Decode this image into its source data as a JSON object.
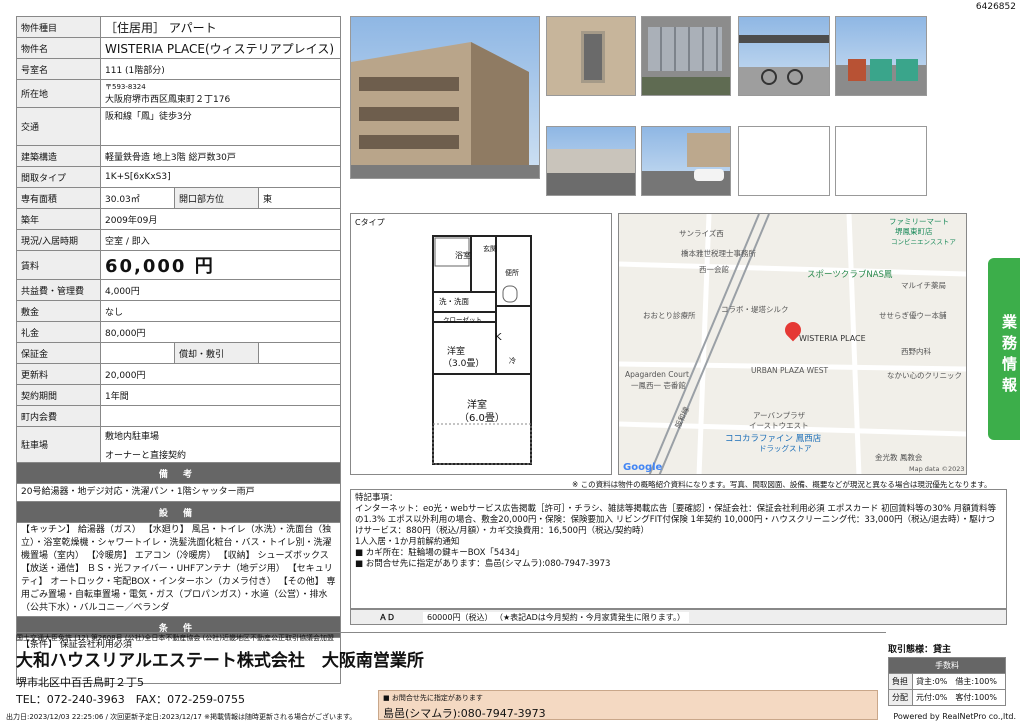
{
  "doc_id": "6426852",
  "spec": {
    "rows": [
      {
        "label": "物件種目",
        "value": "［住居用］ アパート"
      },
      {
        "label": "物件名",
        "value": "WISTERIA PLACE(ウィステリアプレイス)"
      },
      {
        "label": "号室名",
        "value": "111 (1階部分)"
      },
      {
        "label": "所在地",
        "value_top": "〒593-8324",
        "value": "大阪府堺市西区鳳東町２丁176"
      },
      {
        "label": "交通",
        "value": "阪和線「鳳」徒歩3分"
      },
      {
        "label": "建築構造",
        "value": "軽量鉄骨造 地上3階 総戸数30戸"
      },
      {
        "label": "間取タイプ",
        "value": "1K+S[6xKxS3]"
      },
      {
        "label": "専有面積",
        "value": "30.03㎡",
        "label2": "開口部方位",
        "value2": "東"
      },
      {
        "label": "築年",
        "value": "2009年09月"
      },
      {
        "label": "現況/入居時期",
        "value": "空室 / 即入"
      },
      {
        "label": "賃料",
        "value": "60,000 円"
      },
      {
        "label": "共益費・管理費",
        "value": "4,000円"
      },
      {
        "label": "敷金",
        "value": "なし"
      },
      {
        "label": "礼金",
        "value": "80,000円"
      },
      {
        "label": "保証金",
        "value": "",
        "label2": "償却・敷引",
        "value2": ""
      },
      {
        "label": "更新料",
        "value": "20,000円"
      },
      {
        "label": "契約期間",
        "value": "1年間"
      },
      {
        "label": "町内会費",
        "value": ""
      },
      {
        "label": "駐車場",
        "value": "敷地内駐車場",
        "value_b": "オーナーと直接契約"
      }
    ],
    "bikou_title": "備 考",
    "bikou_text": "20号給湯器・地デジ対応・洗濯パン・1階シャッター雨戸",
    "setsubi_title": "設 備",
    "setsubi_text": "【キッチン】 給湯器（ガス） 【水廻り】 風呂・トイレ（水洗）・洗面台（独立）・浴室乾燥機・シャワートイレ・洗髪洗面化粧台・バス・トイレ別・洗濯機置場（室内） 【冷暖房】 エアコン（冷暖房） 【収納】 シューズボックス 【放送・通信】 ＢＳ・光ファイバー・UHFアンテナ（地デジ用） 【セキュリティ】 オートロック・宅配BOX・インターホン（カメラ付き） 【その他】 専用ごみ置場・自転車置場・電気・ガス（プロパンガス）・水道（公営）・排水（公共下水）・バルコニー／ベランダ",
    "joken_title": "条 件",
    "joken_text": "【条件】 保証会社利用必須"
  },
  "floorplan": {
    "caption": "Cタイプ",
    "rooms": [
      "浴室",
      "玄関",
      "洗・洗面",
      "クローゼット",
      "便所",
      "洋室",
      "（3.0畳）",
      "K",
      "冷",
      "洋室",
      "（6.0畳）"
    ]
  },
  "map": {
    "labels": [
      "サンライズ西",
      "橋本雅世税理士事務所",
      "西一会館",
      "ファミリーマート",
      "堺鳳東町店",
      "コンビニエンスストア",
      "スポーツクラブNAS鳳",
      "マルイチ薬局",
      "おおとり診療所",
      "コラボ・堤塔シルク",
      "せせらぎ優ウー本舗",
      "WISTERIA PLACE",
      "西野内科",
      "Apagarden Court",
      "一鳳西一 壱番館",
      "URBAN PLAZA WEST",
      "なかい心のクリニック",
      "阪和線",
      "アーバンプラザ",
      "イーストウエスト",
      "ココカラファイン 鳳西店",
      "ドラッグストア",
      "金光教 鳳教会",
      "Google",
      "Map data ©2023"
    ],
    "note": "※ この資料は物件の概略紹介資料になります。写真、間取図面、設備、概要などが現況と異なる場合は現況優先となります。"
  },
  "remarks": {
    "lines": [
      "特記事項：",
      "インターネット：eo光・webサービス広告掲載［許可］・チラシ、雑誌等掲載広告［要確認］・保証会社：保証会社利用必須 エポスカード 初回賃料等の30% 月額賃料等の1.3% エポス以外利用の場合、敷金20,000円・保険：保険要加入 リビングFIT付保険 1年契約 10,000円・ハウスクリーニング代：33,000円（税込/退去時）・駆けつけサービス：880円（税込/月額）・カギ交換費用：16,500円（税込/契約時）",
      "1人入居・1か月前解約通知",
      "■ カギ所在：駐輪場の鍵キーBOX「5434」",
      "■ お問合せ先に指定があります：島邑(シマムラ):080-7947-3973"
    ],
    "ad_label": "ＡＤ",
    "ad_value": "60000円（税込） （★表記ADは今月契約・今月家賃発生に限ります。）"
  },
  "company": {
    "license": "国土交通大臣免許 (12) 第2608号 (公社)全日本不動産協会 (公社)近畿地区不動産公正取引協議会加盟",
    "name": "大和ハウスリアルエステート株式会社　大阪南営業所",
    "address": "堺市北区中百舌鳥町２丁5",
    "tel": "TEL：072-240-3963　FAX：072-259-0755"
  },
  "trade": {
    "title": "取引態様：貸主",
    "fee_title": "手数料",
    "rows": [
      {
        "label": "負担",
        "value": "貸主:0%　借主:100%"
      },
      {
        "label": "分配",
        "value": "元付:0%　客付:100%"
      }
    ]
  },
  "contact": {
    "note": "■ お問合せ先に指定があります",
    "value": "島邑(シマムラ):080-7947-3973"
  },
  "footer": {
    "left": "出力日:2023/12/03 22:25:06 / 次回更新予定日:2023/12/17 ※掲載情報は随時更新される場合がございます。",
    "right": "Powered by RealNetPro co.,ltd."
  },
  "side_tab": "業務情報",
  "colors": {
    "accent_green": "#3cae4a",
    "section_gray": "#666666",
    "contact_bg": "#f4d9c2"
  }
}
